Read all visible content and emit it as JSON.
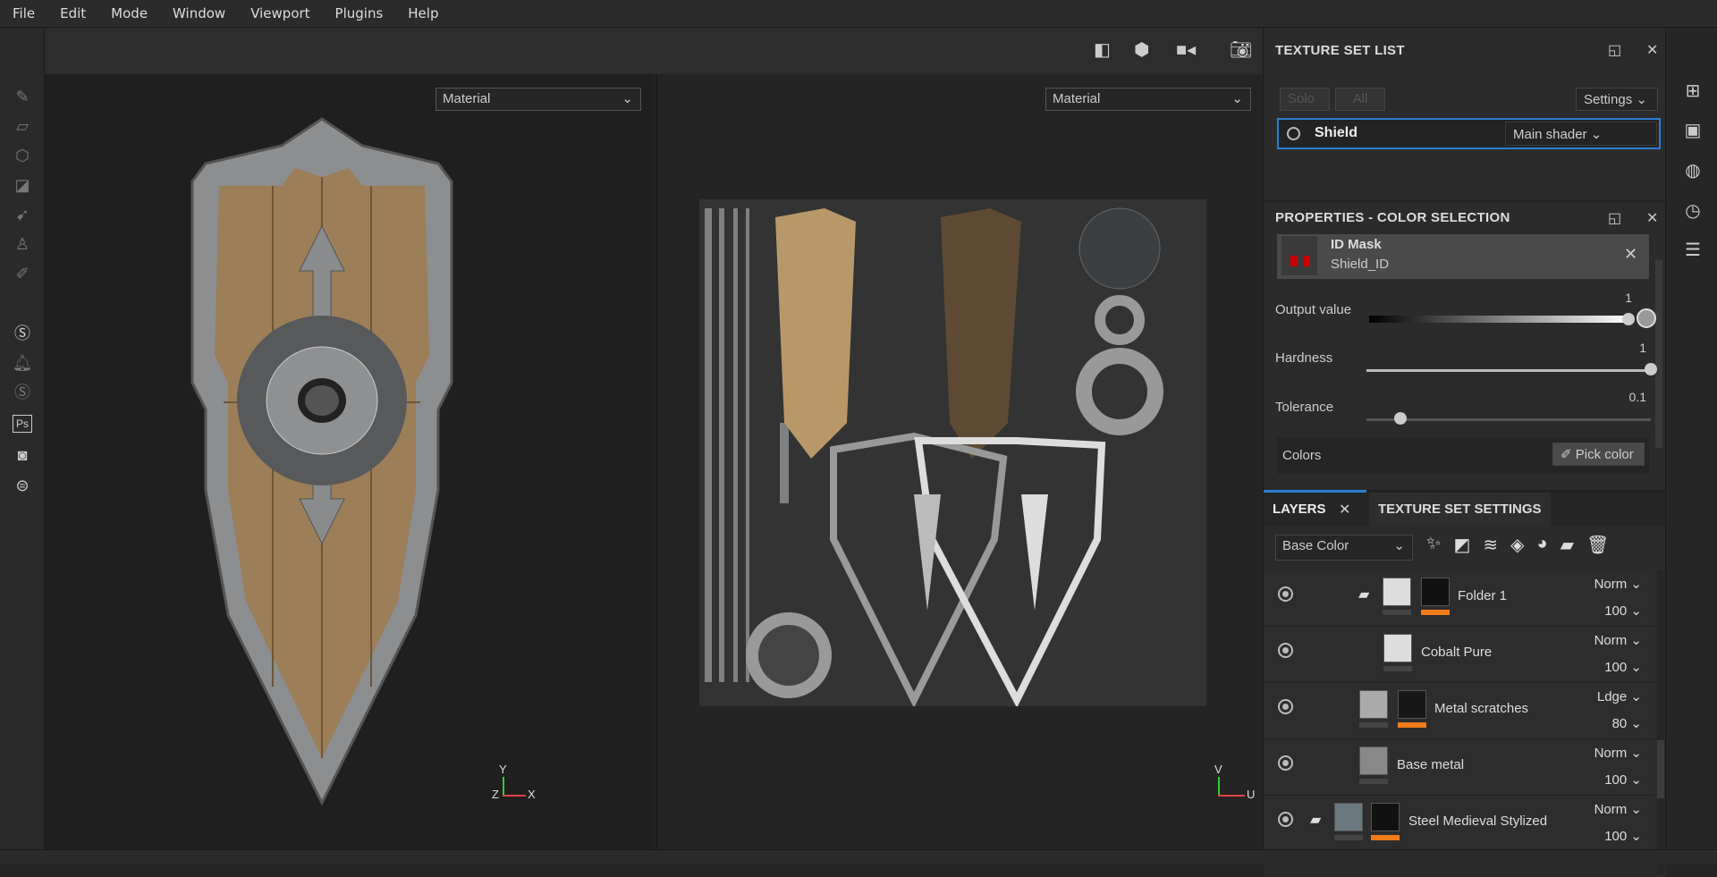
{
  "menu": [
    "File",
    "Edit",
    "Mode",
    "Window",
    "Viewport",
    "Plugins",
    "Help"
  ],
  "viewport3d": {
    "channel": "Material",
    "axes": [
      "Y",
      "Z",
      "X"
    ]
  },
  "viewport2d": {
    "channel": "Material",
    "axes": [
      "V",
      "U"
    ]
  },
  "texture_set_list": {
    "title": "TEXTURE SET LIST",
    "solo": "Solo",
    "all": "All",
    "settings": "Settings",
    "item": {
      "name": "Shield",
      "shader": "Main shader"
    }
  },
  "properties": {
    "title": "PROPERTIES - COLOR SELECTION",
    "mask_name": "ID Mask",
    "mask_source": "Shield_ID",
    "output_label": "Output value",
    "output_value": "1",
    "output_fraction": 1,
    "hardness_label": "Hardness",
    "hardness_value": "1",
    "hardness_fraction": 1,
    "tolerance_label": "Tolerance",
    "tolerance_value": "0.1",
    "tolerance_fraction": 0.12,
    "colors_label": "Colors",
    "pick_color": "Pick color"
  },
  "layers_panel": {
    "tab_layers": "LAYERS",
    "tab_tss": "TEXTURE SET SETTINGS",
    "channel": "Base Color",
    "layers": [
      {
        "name": "Folder 1",
        "blend": "Norm",
        "opacity": "100"
      },
      {
        "name": "Cobalt Pure",
        "blend": "Norm",
        "opacity": "100"
      },
      {
        "name": "Metal scratches",
        "blend": "Ldge",
        "opacity": "80"
      },
      {
        "name": "Base metal",
        "blend": "Norm",
        "opacity": "100"
      },
      {
        "name": "Steel Medieval Stylized",
        "blend": "Norm",
        "opacity": "100"
      }
    ]
  },
  "colors": {
    "accent": "#2a7fd4",
    "mask_orange": "#f07c1c"
  }
}
